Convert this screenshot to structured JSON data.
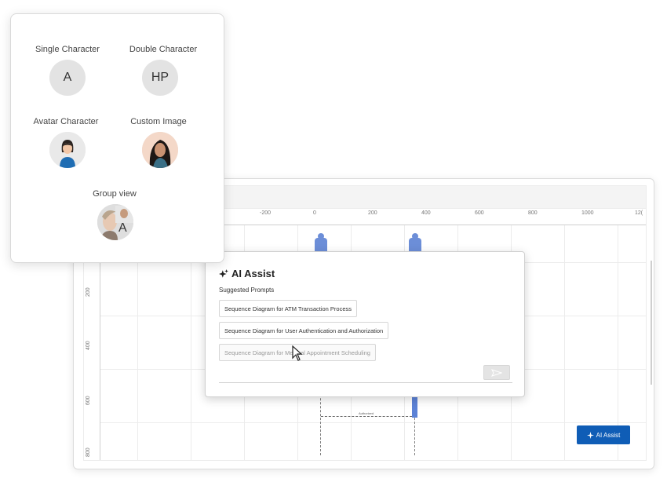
{
  "avatar_card": {
    "single_label": "Single Character",
    "single_value": "A",
    "double_label": "Double Character",
    "double_value": "HP",
    "avatar_label": "Avatar Character",
    "custom_label": "Custom Image",
    "group_label": "Group view",
    "group_initial": "A"
  },
  "diagram": {
    "ruler_x": [
      "-200",
      "0",
      "200",
      "400",
      "600",
      "800",
      "1000",
      "12("
    ],
    "ruler_y": [
      "200",
      "400",
      "600",
      "800"
    ],
    "message_label": "Authorized"
  },
  "ai_dialog": {
    "title": "AI Assist",
    "subtitle": "Suggested Prompts",
    "prompts": [
      "Sequence Diagram for ATM Transaction Process",
      "Sequence Diagram for User Authentication and Authorization",
      "Sequence Diagram for Medical Appointment Scheduling"
    ],
    "input_placeholder": ""
  },
  "ai_button_label": "AI Assist",
  "colors": {
    "accent": "#0f5db6",
    "actor": "#6c8ed8"
  },
  "icons": [
    "sparkle-icon",
    "send-icon",
    "mouse-cursor-icon"
  ]
}
